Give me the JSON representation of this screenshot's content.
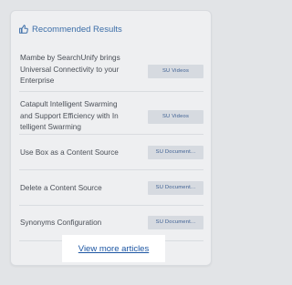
{
  "widget": {
    "header_icon": "thumbs-up-icon",
    "title": "Recommended Results",
    "view_more_label": "View more articles"
  },
  "results": [
    {
      "title_lines": [
        "Mambe by SearchUnify brings",
        "Universal Connectivity to your",
        "Enterprise"
      ],
      "badge": "SU Videos"
    },
    {
      "title_lines": [
        "Catapult Intelligent Swarming",
        "and Support Efficiency with In",
        "telligent Swarming"
      ],
      "badge": "SU Videos"
    },
    {
      "title_lines": [
        "Use Box as a Content Source"
      ],
      "badge": "SU Document..."
    },
    {
      "title_lines": [
        "Delete a Content Source"
      ],
      "badge": "SU Document..."
    },
    {
      "title_lines": [
        "Synonyms Configuration"
      ],
      "badge": "SU Document..."
    }
  ],
  "colors": {
    "accent": "#3c6ea8",
    "link": "#1d56a3",
    "badge_bg": "#d6dae0",
    "badge_text": "#3d5f92"
  }
}
